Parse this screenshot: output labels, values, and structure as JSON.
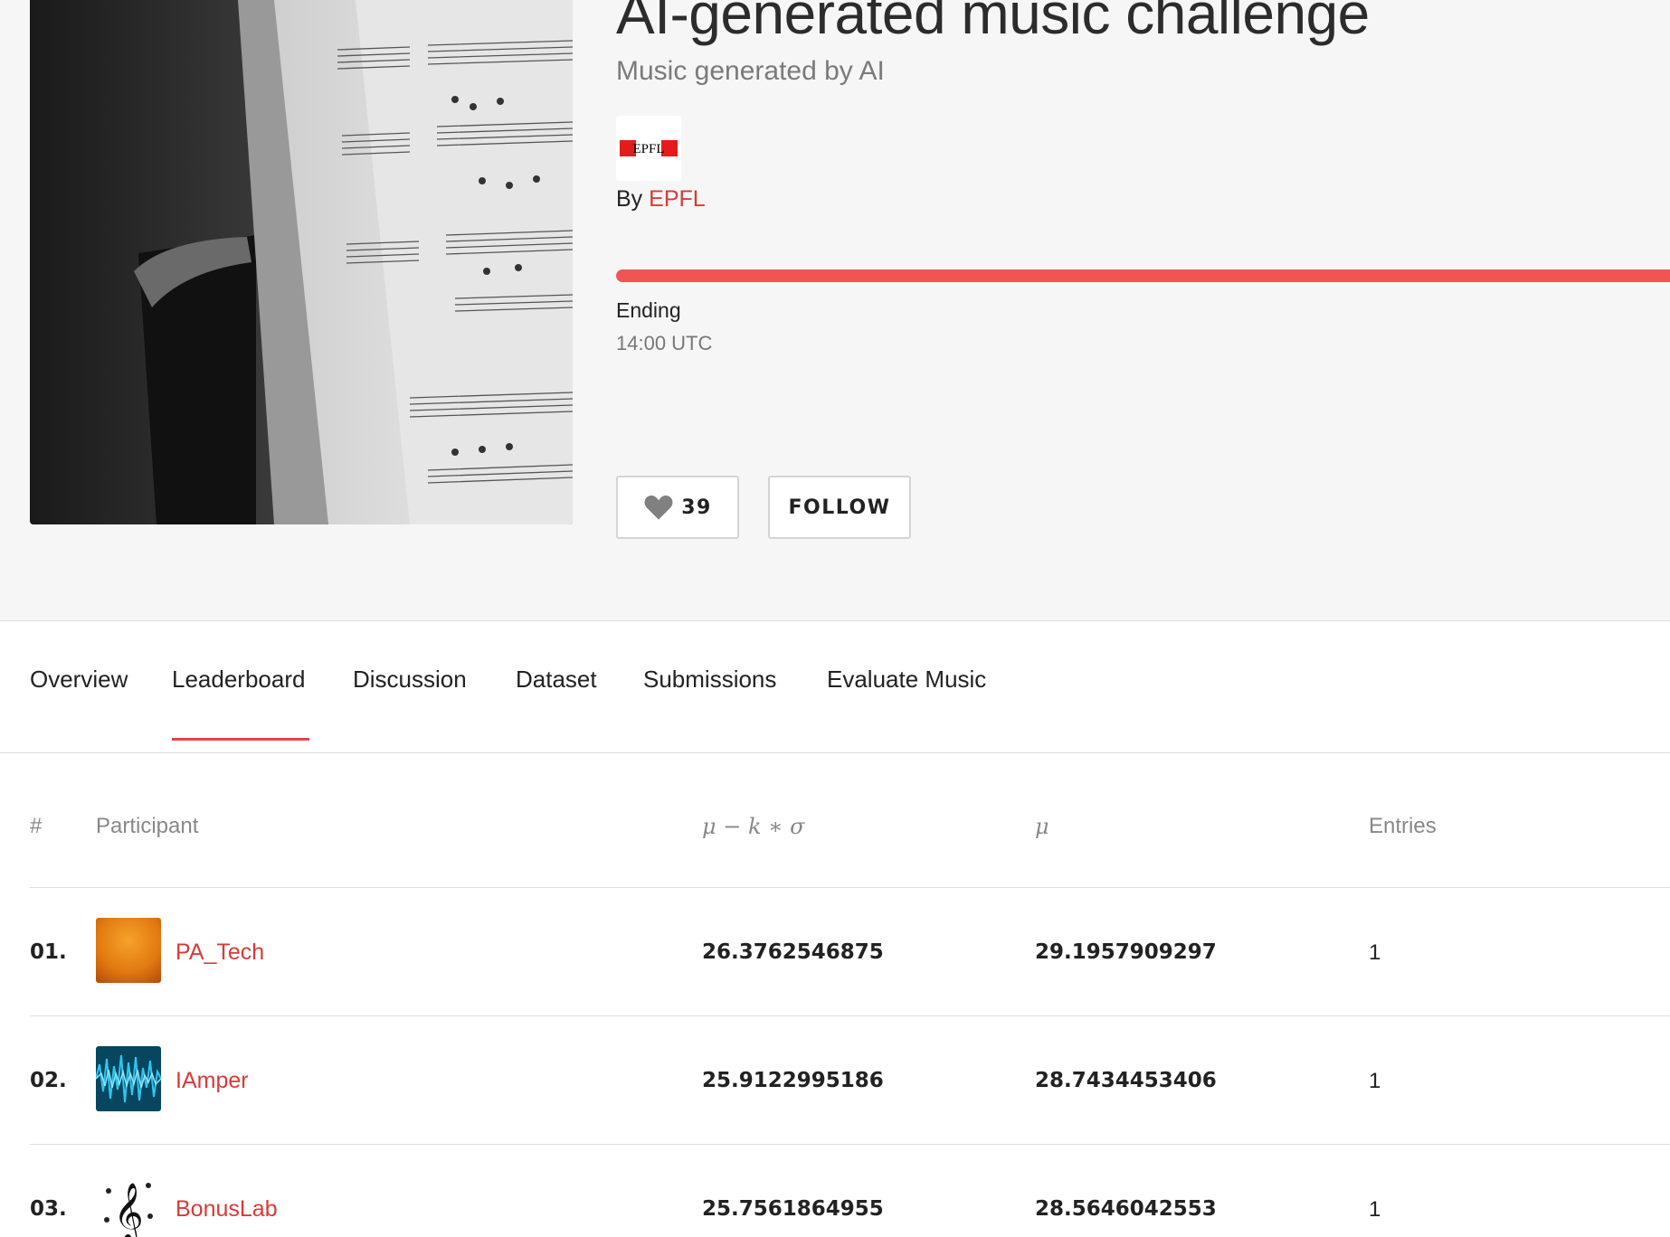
{
  "challenge": {
    "title": "AI-generated music challenge",
    "subtitle": "Music generated by AI",
    "by_label": "By",
    "org_name": "EPFL",
    "org_logo_text": "EPFL",
    "progress_fraction": 1.0,
    "ending_label": "Ending",
    "ending_time": "14:00 UTC",
    "likes": "39",
    "follow_label": "FOLLOW",
    "accent_color": "#ef5555",
    "like_icon": "heart-icon"
  },
  "tabs": [
    {
      "label": "Overview",
      "active": false
    },
    {
      "label": "Leaderboard",
      "active": true
    },
    {
      "label": "Discussion",
      "active": false
    },
    {
      "label": "Dataset",
      "active": false
    },
    {
      "label": "Submissions",
      "active": false
    },
    {
      "label": "Evaluate Music",
      "active": false
    }
  ],
  "leaderboard": {
    "headers": {
      "rank": "#",
      "participant": "Participant",
      "score": "μ − k ∗ σ",
      "mean": "μ",
      "entries": "Entries"
    },
    "rows": [
      {
        "rank": "01.",
        "name": "PA_Tech",
        "score": "26.3762546875",
        "mean": "29.1957909297",
        "entries": "1",
        "avatar": "orange-gradient"
      },
      {
        "rank": "02.",
        "name": "IAmper",
        "score": "25.9122995186",
        "mean": "28.7434453406",
        "entries": "1",
        "avatar": "blue-waveform"
      },
      {
        "rank": "03.",
        "name": "BonusLab",
        "score": "25.7561864955",
        "mean": "28.5646042553",
        "entries": "1",
        "avatar": "treble-clef"
      }
    ]
  }
}
